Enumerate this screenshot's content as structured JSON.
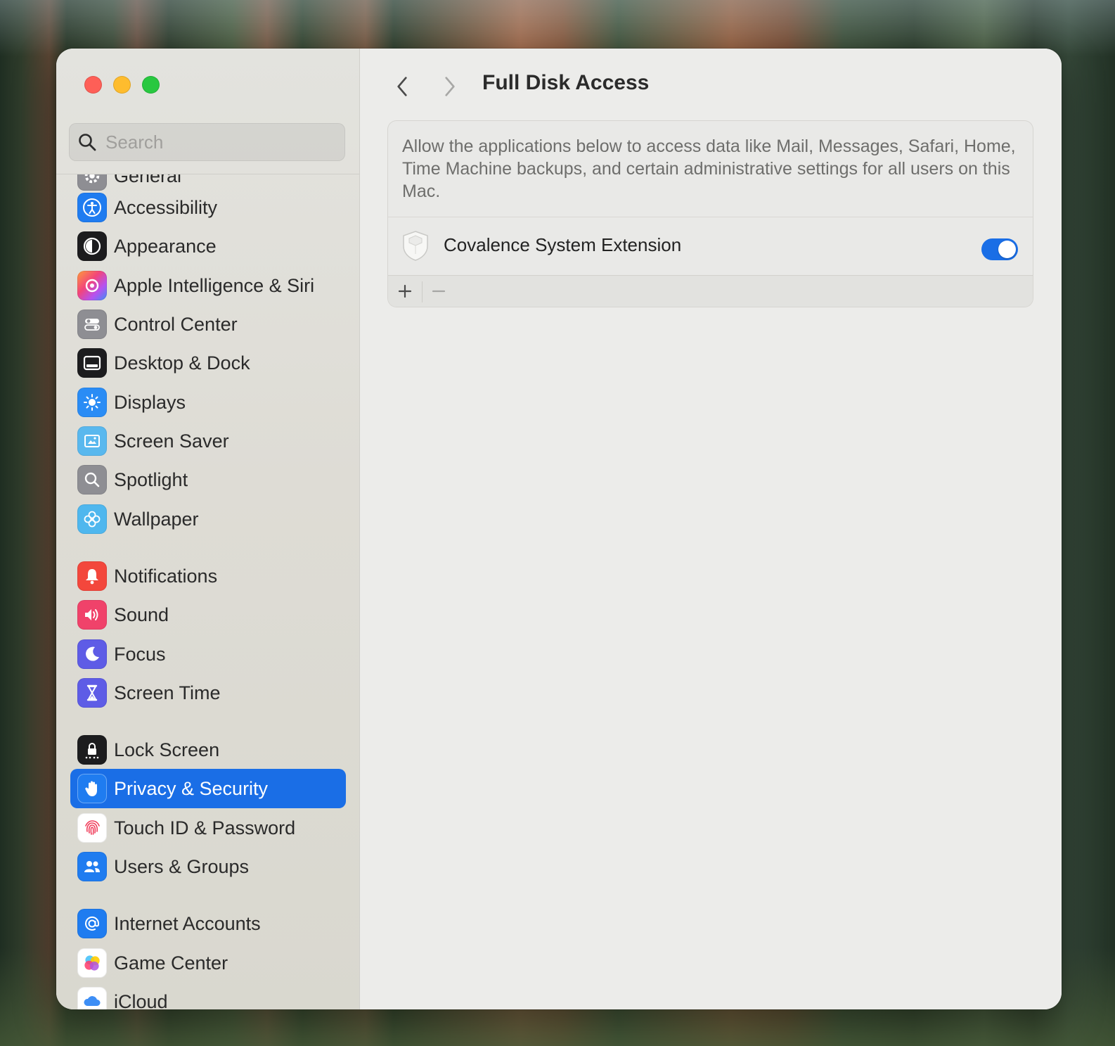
{
  "window": {
    "title": "Full Disk Access",
    "traffic_lights": {
      "close": "#fe5f57",
      "minimize": "#febc2e",
      "zoom": "#28c840"
    }
  },
  "search": {
    "placeholder": "Search",
    "value": ""
  },
  "sidebar": {
    "selected": "Privacy & Security",
    "items": [
      {
        "label": "General",
        "icon": "gear-icon",
        "color": "#8e8e93"
      },
      {
        "label": "Accessibility",
        "icon": "accessibility-icon",
        "color": "#1f7cf0"
      },
      {
        "label": "Appearance",
        "icon": "appearance-icon",
        "color": "#1c1c1e"
      },
      {
        "label": "Apple Intelligence & Siri",
        "icon": "siri-icon",
        "color": "#e15bd0"
      },
      {
        "label": "Control Center",
        "icon": "control-center-icon",
        "color": "#8e8e93"
      },
      {
        "label": "Desktop & Dock",
        "icon": "dock-icon",
        "color": "#1c1c1e"
      },
      {
        "label": "Displays",
        "icon": "sun-icon",
        "color": "#2a8cf5"
      },
      {
        "label": "Screen Saver",
        "icon": "screen-saver-icon",
        "color": "#59b8ee"
      },
      {
        "label": "Spotlight",
        "icon": "magnifier-icon",
        "color": "#8e8e93"
      },
      {
        "label": "Wallpaper",
        "icon": "flower-icon",
        "color": "#4fb7ee"
      },
      {
        "label": "Notifications",
        "icon": "bell-icon",
        "color": "#f3473c"
      },
      {
        "label": "Sound",
        "icon": "speaker-icon",
        "color": "#f0426a"
      },
      {
        "label": "Focus",
        "icon": "moon-icon",
        "color": "#5e5ce6"
      },
      {
        "label": "Screen Time",
        "icon": "hourglass-icon",
        "color": "#5e5ce6"
      },
      {
        "label": "Lock Screen",
        "icon": "lock-icon",
        "color": "#1c1c1e"
      },
      {
        "label": "Privacy & Security",
        "icon": "hand-icon",
        "color": "#1f7cf0"
      },
      {
        "label": "Touch ID & Password",
        "icon": "fingerprint-icon",
        "color": "#ffffff"
      },
      {
        "label": "Users & Groups",
        "icon": "users-icon",
        "color": "#1f7cf0"
      },
      {
        "label": "Internet Accounts",
        "icon": "at-icon",
        "color": "#1f7cf0"
      },
      {
        "label": "Game Center",
        "icon": "game-center-icon",
        "color": "#ffffff"
      },
      {
        "label": "iCloud",
        "icon": "icloud-icon",
        "color": "#ffffff"
      }
    ]
  },
  "main": {
    "description": "Allow the applications below to access data like Mail, Messages, Safari, Home, Time Machine backups, and certain administrative settings for all users on this Mac.",
    "apps": [
      {
        "name": "Covalence System Extension",
        "icon": "extension-shield-icon",
        "enabled": true
      }
    ],
    "accent": "#1a6ee6"
  }
}
